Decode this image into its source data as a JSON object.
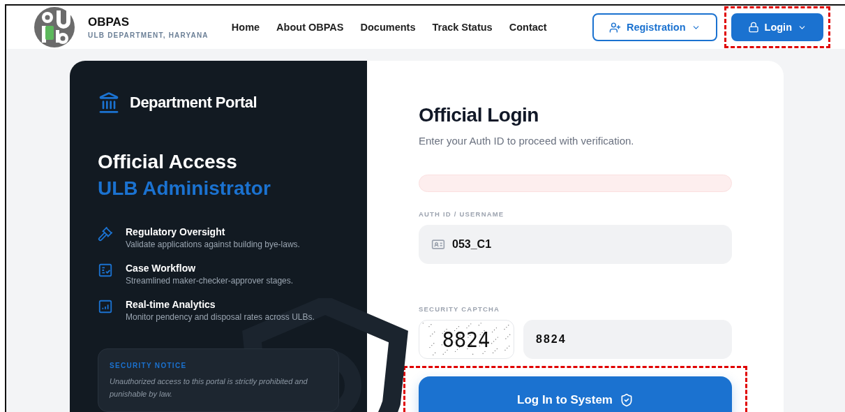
{
  "header": {
    "brand": "OBPAS",
    "subtitle": "ULB DEPARTMENT, HARYANA",
    "nav": [
      {
        "label": "Home",
        "selected": false
      },
      {
        "label": "About OBPAS",
        "selected": false
      },
      {
        "label": "Documents",
        "selected": false
      },
      {
        "label": "Track Status",
        "selected": false
      },
      {
        "label": "Contact",
        "selected": false
      }
    ],
    "actions": [
      {
        "kind": "outline",
        "label": "Registration",
        "highlighted": false
      },
      {
        "kind": "solid",
        "label": "Login",
        "highlighted": true
      }
    ]
  },
  "info_panel": {
    "portal_title": "Department Portal",
    "heading": "Official Access",
    "subheading": "ULB Administrator",
    "features": [
      {
        "kind": "gavel",
        "title": "Regulatory Oversight",
        "text": "Validate applications against building bye-laws."
      },
      {
        "kind": "checklist",
        "title": "Case Workflow",
        "text": "Streamlined maker-checker-approver stages."
      },
      {
        "kind": "chart",
        "title": "Real-time Analytics",
        "text": "Monitor pendency and disposal rates across ULBs."
      }
    ],
    "notice": {
      "title": "SECURITY NOTICE",
      "text": "Unauthorized access to this portal is strictly prohibited and punishable by law."
    }
  },
  "login_form": {
    "title": "Official Login",
    "subtitle": "Enter your Auth ID to proceed with verification.",
    "alert_visible": true,
    "username": {
      "label": "AUTH ID / USERNAME",
      "value": "053_C1"
    },
    "captcha": {
      "label": "SECURITY CAPTCHA",
      "image_text": "8824",
      "value": "8824"
    },
    "submit": {
      "label": "Log In to System",
      "highlighted": true
    }
  }
}
